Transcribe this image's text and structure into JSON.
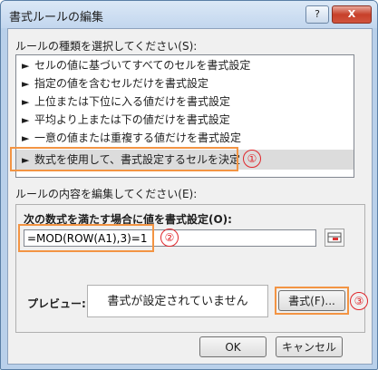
{
  "window": {
    "title": "書式ルールの編集",
    "help_label": "?",
    "close_label": "X"
  },
  "rule_type": {
    "label": "ルールの種類を選択してください(S):",
    "items": [
      {
        "label": "セルの値に基づいてすべてのセルを書式設定"
      },
      {
        "label": "指定の値を含むセルだけを書式設定"
      },
      {
        "label": "上位または下位に入る値だけを書式設定"
      },
      {
        "label": "平均より上または下の値だけを書式設定"
      },
      {
        "label": "一意の値または重複する値だけを書式設定"
      },
      {
        "label": "数式を使用して、書式設定するセルを決定"
      }
    ],
    "selected_index": 5,
    "arrow_glyph": "►"
  },
  "rule_edit": {
    "label": "ルールの内容を編集してください(E):",
    "subhead": "次の数式を満たす場合に値を書式設定(O):",
    "formula": "=MOD(ROW(A1),3)=1",
    "preview_label": "プレビュー:",
    "preview_text": "書式が設定されていません",
    "format_button": "書式(F)..."
  },
  "buttons": {
    "ok": "OK",
    "cancel": "キャンセル"
  },
  "annotations": {
    "one": "①",
    "two": "②",
    "three": "③"
  },
  "colors": {
    "annotation_box": "#f39443",
    "annotation_circle": "#e0262b",
    "selected_row": "#dcdcdc"
  }
}
